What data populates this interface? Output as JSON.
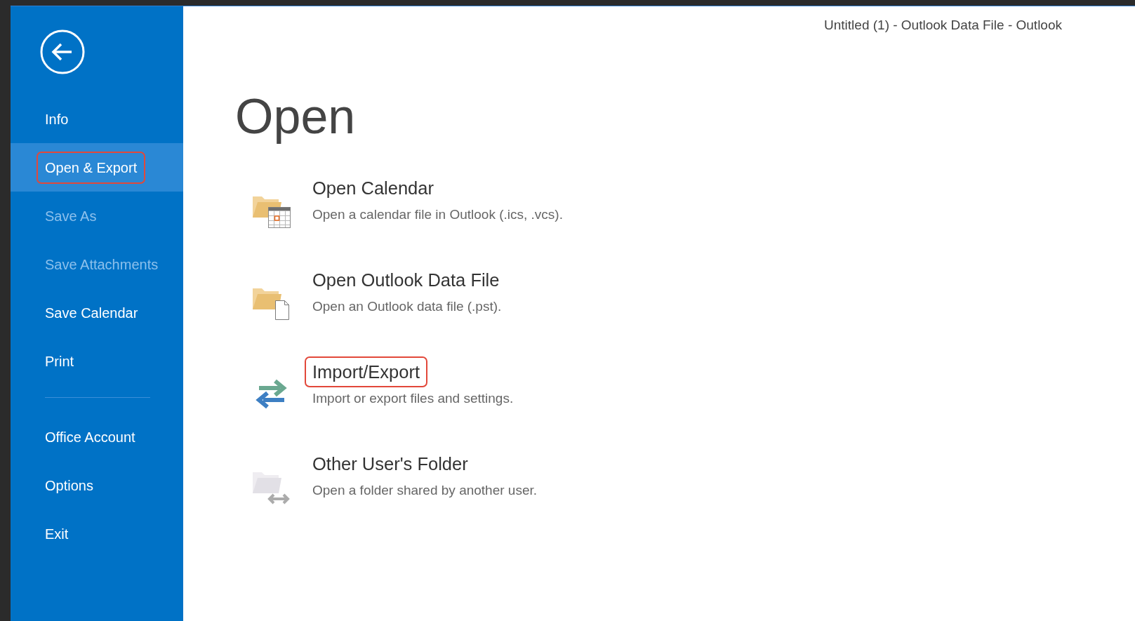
{
  "window": {
    "title": "Untitled (1) - Outlook Data File - Outlook"
  },
  "sidebar": {
    "items": [
      {
        "label": "Info",
        "selected": false,
        "disabled": false,
        "highlighted": false
      },
      {
        "label": "Open & Export",
        "selected": true,
        "disabled": false,
        "highlighted": true
      },
      {
        "label": "Save As",
        "selected": false,
        "disabled": true,
        "highlighted": false
      },
      {
        "label": "Save Attachments",
        "selected": false,
        "disabled": true,
        "highlighted": false
      },
      {
        "label": "Save Calendar",
        "selected": false,
        "disabled": false,
        "highlighted": false
      },
      {
        "label": "Print",
        "selected": false,
        "disabled": false,
        "highlighted": false
      }
    ],
    "footer_items": [
      {
        "label": "Office Account",
        "selected": false,
        "disabled": false,
        "highlighted": false
      },
      {
        "label": "Options",
        "selected": false,
        "disabled": false,
        "highlighted": false
      },
      {
        "label": "Exit",
        "selected": false,
        "disabled": false,
        "highlighted": false
      }
    ]
  },
  "page": {
    "heading": "Open",
    "entries": [
      {
        "kind": "calendar",
        "title": "Open Calendar",
        "description": "Open a calendar file in Outlook (.ics, .vcs).",
        "highlighted": false
      },
      {
        "kind": "data-file",
        "title": "Open Outlook Data File",
        "description": "Open an Outlook data file (.pst).",
        "highlighted": false
      },
      {
        "kind": "import-export",
        "title": "Import/Export",
        "description": "Import or export files and settings.",
        "highlighted": true
      },
      {
        "kind": "shared-folder",
        "title": "Other User's Folder",
        "description": "Open a folder shared by another user.",
        "highlighted": false
      }
    ]
  }
}
